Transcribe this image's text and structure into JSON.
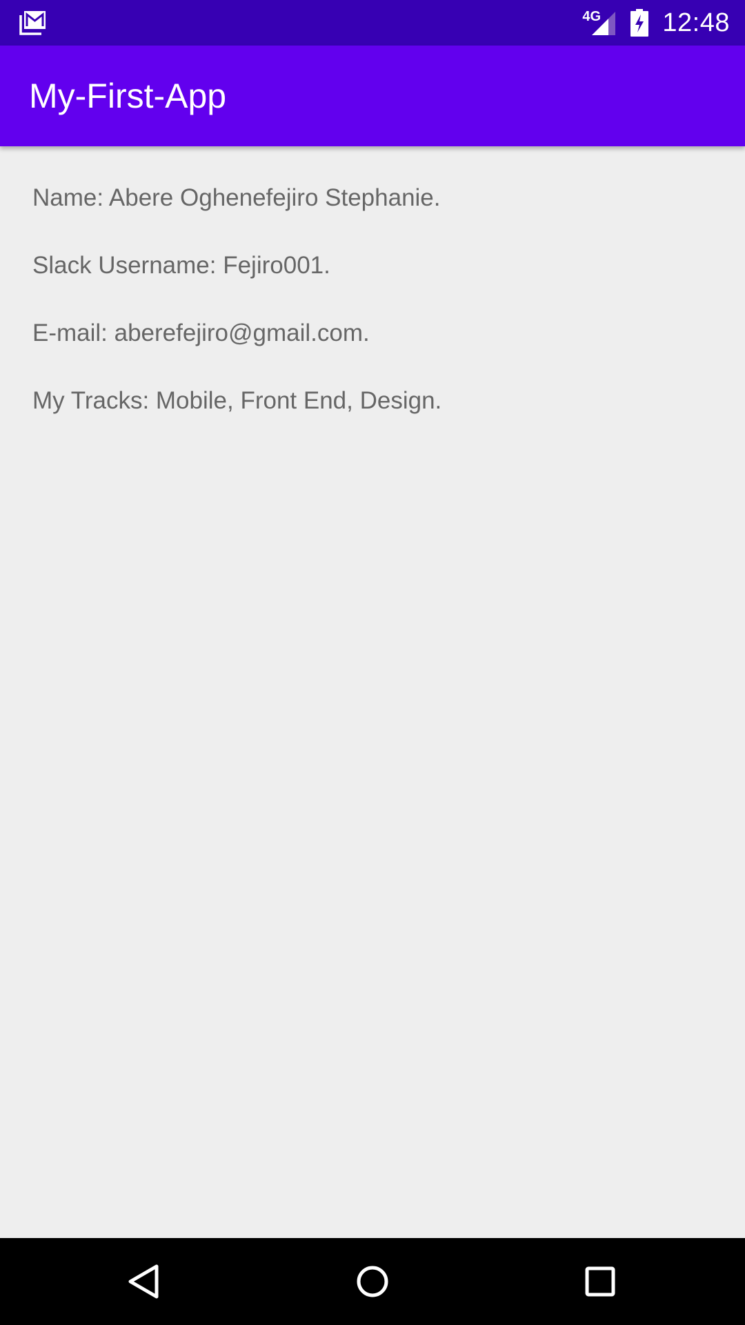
{
  "status_bar": {
    "notification_icon": "gmail-icon",
    "network_type": "4G",
    "signal_icon": "cell-signal-icon",
    "battery_icon": "battery-charging-icon",
    "time": "12:48"
  },
  "app_bar": {
    "title": "My-First-App"
  },
  "content": {
    "lines": [
      "Name: Abere Oghenefejiro Stephanie.",
      "Slack Username: Fejiro001.",
      "E-mail: aberefejiro@gmail.com.",
      "My Tracks: Mobile, Front End, Design."
    ]
  },
  "nav_bar": {
    "back_icon": "back-triangle-icon",
    "home_icon": "home-circle-icon",
    "recents_icon": "recents-square-icon"
  },
  "colors": {
    "status_bar": "#3700B3",
    "app_bar": "#6200EE",
    "background": "#EEEEEE",
    "text": "#666666",
    "nav_bar": "#000000"
  }
}
